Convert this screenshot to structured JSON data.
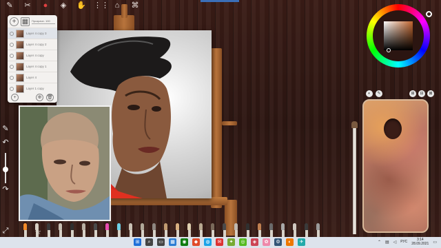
{
  "toolbar": {
    "icons": [
      "wrench-icon",
      "brush-settings-icon",
      "record-icon",
      "layers-icon",
      "hand-icon",
      "grid-icon",
      "easel-icon",
      "camera-icon"
    ],
    "glyphs": [
      "✎",
      "✂",
      "●",
      "◈",
      "✋",
      "⋮⋮",
      "⌂",
      "⌘"
    ]
  },
  "layers_panel": {
    "blend_label": "Прозрачн. 100",
    "items": [
      {
        "label": "Layer 4 copy 3",
        "active": true
      },
      {
        "label": "Layer 4 copy 2",
        "active": false
      },
      {
        "label": "Layer 4 copy",
        "active": false
      },
      {
        "label": "Layer 4 copy 1",
        "active": false
      },
      {
        "label": "Layer 4",
        "active": false
      },
      {
        "label": "Layer 1 copy",
        "active": false
      }
    ],
    "add_glyph": "+",
    "foot_glyphs": [
      "+",
      "⊕",
      "🗑"
    ]
  },
  "left_tools": {
    "glyphs": [
      "✎",
      "↶",
      "↷",
      "⤢"
    ]
  },
  "palette_buttons": [
    "◐",
    "✎",
    "⊞",
    "⊟",
    "⊠"
  ],
  "brush_tray": {
    "colors": [
      "#f08a2a",
      "#d8d0c4",
      "#3a3a3a",
      "#c8c0b4",
      "#2e2e2e",
      "#b8b0a4",
      "#4a4a4a",
      "#e84bb0",
      "#6ed0e8",
      "#c8c0b4",
      "#b0a898",
      "#8e8680",
      "#c09a70",
      "#d8b080",
      "#e0d0b0",
      "#b8a890",
      "#7a6a5a",
      "#4a4a4a",
      "#c0b8b0",
      "#303030",
      "#c08050",
      "#6a6a6a",
      "#a8a8a8",
      "#d0c8c0",
      "#3a3a3a",
      "#9a9a9a"
    ]
  },
  "taskbar": {
    "apps": [
      "⊞",
      "⌕",
      "▭",
      "▦",
      "◉",
      "◆",
      "◍",
      "✉",
      "✦",
      "◎",
      "◈",
      "✿",
      "⚙",
      "◐",
      "✈"
    ],
    "app_colors": [
      "#1e6fd9",
      "#444",
      "#444",
      "#2b7cd3",
      "#0f7b0f",
      "#e04b2a",
      "#1aa3e8",
      "#d33",
      "#7a3",
      "#5b2",
      "#c45",
      "#e8a",
      "#357",
      "#e70",
      "#2aa"
    ],
    "lang": "РУС",
    "time": "3:14",
    "date": "28.09.2021"
  }
}
